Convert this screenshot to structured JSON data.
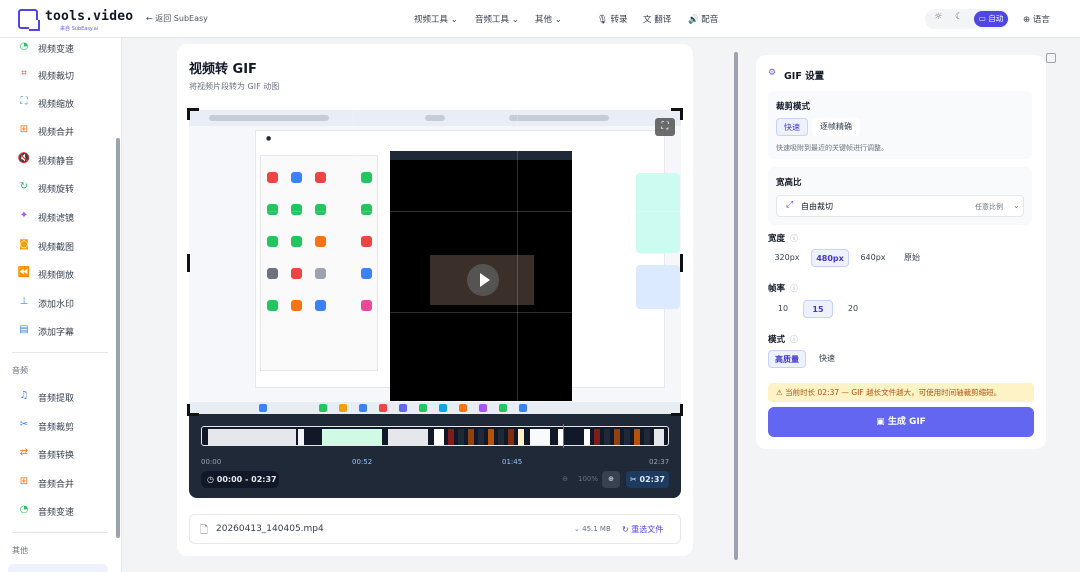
{
  "header": {
    "logo_text": "tools.video",
    "logo_sub": "来自 SubEasy.ai",
    "back_label": "返回 SubEasy",
    "nav": [
      "视频工具",
      "音频工具",
      "其他",
      "转录",
      "翻译",
      "配音"
    ],
    "theme_auto": "自动",
    "language": "语言"
  },
  "sidebar": {
    "video_items": [
      {
        "label": "视频变速",
        "icon": "speed-icon"
      },
      {
        "label": "视频裁切",
        "icon": "crop-icon"
      },
      {
        "label": "视频缩放",
        "icon": "scale-icon"
      },
      {
        "label": "视频合并",
        "icon": "merge-icon"
      },
      {
        "label": "视频静音",
        "icon": "mute-icon"
      },
      {
        "label": "视频旋转",
        "icon": "rotate-icon"
      },
      {
        "label": "视频滤镜",
        "icon": "filter-icon"
      },
      {
        "label": "视频截图",
        "icon": "camera-icon"
      },
      {
        "label": "视频倒放",
        "icon": "rewind-icon"
      },
      {
        "label": "添加水印",
        "icon": "stamp-icon"
      },
      {
        "label": "添加字幕",
        "icon": "subtitle-icon"
      }
    ],
    "audio_heading": "音频",
    "audio_items": [
      {
        "label": "音频提取",
        "icon": "music-icon"
      },
      {
        "label": "音频裁剪",
        "icon": "scissors-icon"
      },
      {
        "label": "音频转换",
        "icon": "convert-icon"
      },
      {
        "label": "音频合并",
        "icon": "merge-icon"
      },
      {
        "label": "音频变速",
        "icon": "speed-icon"
      }
    ],
    "other_heading": "其他"
  },
  "main": {
    "title": "视频转 GIF",
    "subtitle": "将视频片段转为 GIF 动图",
    "timeline": {
      "ticks": [
        "00:00",
        "00:52",
        "01:45",
        "02:37"
      ],
      "range": "00:00 - 02:37",
      "zoom": "100%",
      "duration": "02:37",
      "playhead_fraction": 0.8
    },
    "file": {
      "name": "20260413_140405.mp4",
      "size": "45.1 MB",
      "reselect": "重选文件"
    }
  },
  "settings": {
    "title": "GIF 设置",
    "crop_mode": {
      "label": "裁剪模式",
      "options": [
        "快速",
        "逐帧精确"
      ],
      "selected": "快速",
      "hint": "快速吸附到最近的关键帧进行调整。"
    },
    "aspect": {
      "label": "宽高比",
      "value": "自由裁切",
      "hint": "任意比例"
    },
    "width": {
      "label": "宽度",
      "options": [
        "320px",
        "480px",
        "640px",
        "原始"
      ],
      "selected": "480px"
    },
    "fps": {
      "label": "帧率",
      "options": [
        "10",
        "15",
        "20"
      ],
      "selected": "15"
    },
    "mode": {
      "label": "模式",
      "options": [
        "高质量",
        "快速"
      ],
      "selected": "高质量"
    },
    "warning": "当前时长 02:37 — GIF 越长文件越大，可使用时间轴裁剪缩短。",
    "generate": "生成 GIF"
  },
  "colors": {
    "accent": "#6366f1",
    "warning_bg": "#fef3c7"
  }
}
